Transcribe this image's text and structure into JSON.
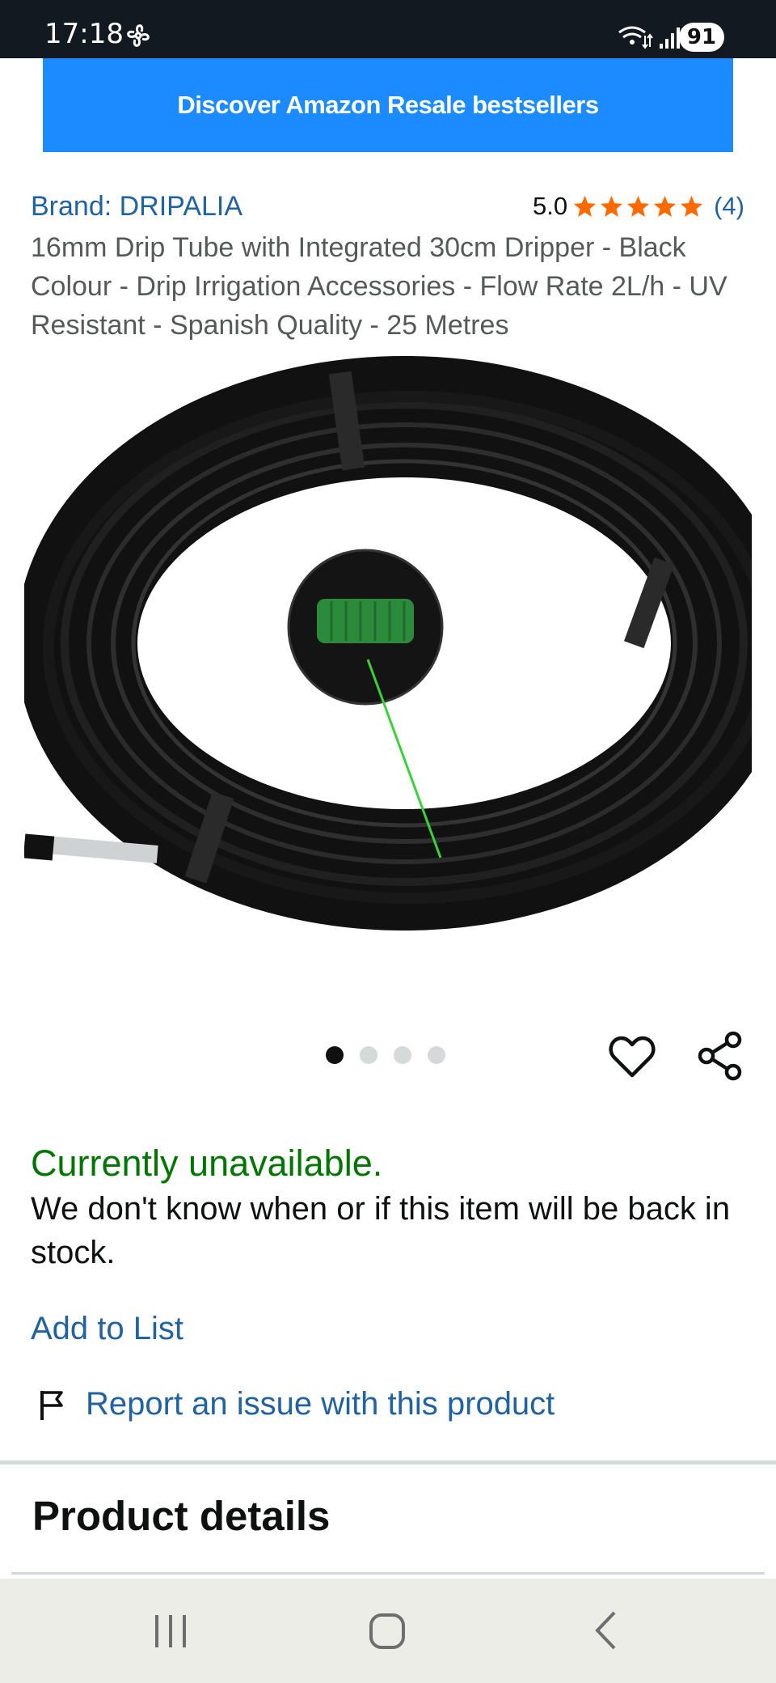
{
  "status_bar": {
    "time": "17:18",
    "battery": "91"
  },
  "banner": {
    "text": "Discover Amazon Resale bestsellers"
  },
  "product": {
    "brand": "Brand: DRIPALIA",
    "rating_value": "5.0",
    "rating_count": "(4)",
    "stars": 5,
    "title": "16mm Drip Tube with Integrated 30cm Dripper - Black Colour - Drip Irrigation Accessories - Flow Rate 2L/h - UV Resistant - Spanish Quality - 25 Metres",
    "image_count": 4,
    "active_image": 1
  },
  "availability": {
    "status": "Currently unavailable.",
    "message": "We don't know when or if this item will be back in stock."
  },
  "actions": {
    "add_to_list": "Add to List",
    "report": "Report an issue with this product"
  },
  "sections": {
    "product_details": "Product details"
  },
  "colors": {
    "status_bar": "#131921",
    "banner": "#1B8BFF",
    "link": "#2162A1",
    "available": "#007600",
    "star": "#FF6A00"
  },
  "icons": [
    "fan-icon",
    "wifi-icon",
    "signal-icon",
    "star-icon",
    "heart-icon",
    "share-icon",
    "flag-icon",
    "recent-apps-icon",
    "home-icon",
    "back-icon"
  ]
}
